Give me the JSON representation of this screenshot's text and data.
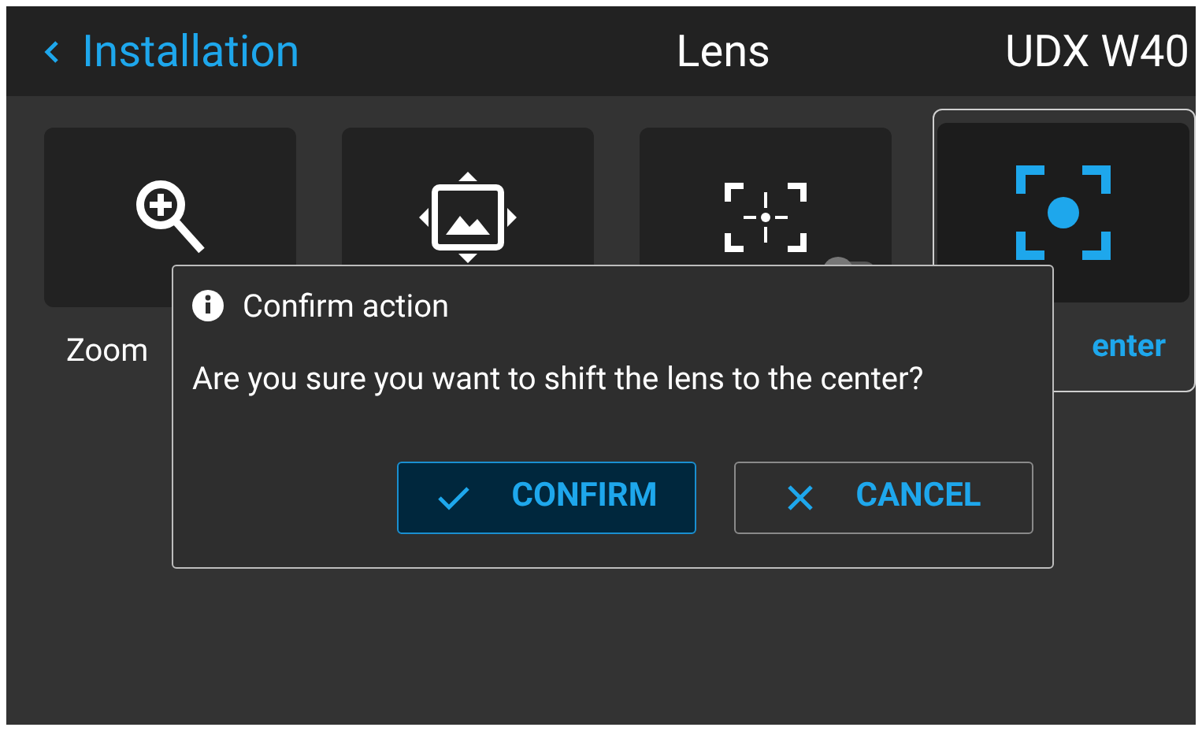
{
  "header": {
    "back_label": "Installation",
    "title": "Lens",
    "device": "UDX W40"
  },
  "tiles": [
    {
      "label": "Zoom",
      "kind": "zoom",
      "selected": false
    },
    {
      "kind": "shift",
      "selected": false
    },
    {
      "kind": "focus",
      "selected": false,
      "toggle": {
        "on": false
      }
    },
    {
      "label": "enter",
      "kind": "center",
      "selected": true
    }
  ],
  "dialog": {
    "title": "Confirm action",
    "message": "Are you sure you want to shift the lens to the center?",
    "buttons": [
      {
        "label": "CONFIRM",
        "kind": "confirm",
        "selected": true
      },
      {
        "label": "CANCEL",
        "kind": "cancel",
        "selected": false
      }
    ]
  }
}
